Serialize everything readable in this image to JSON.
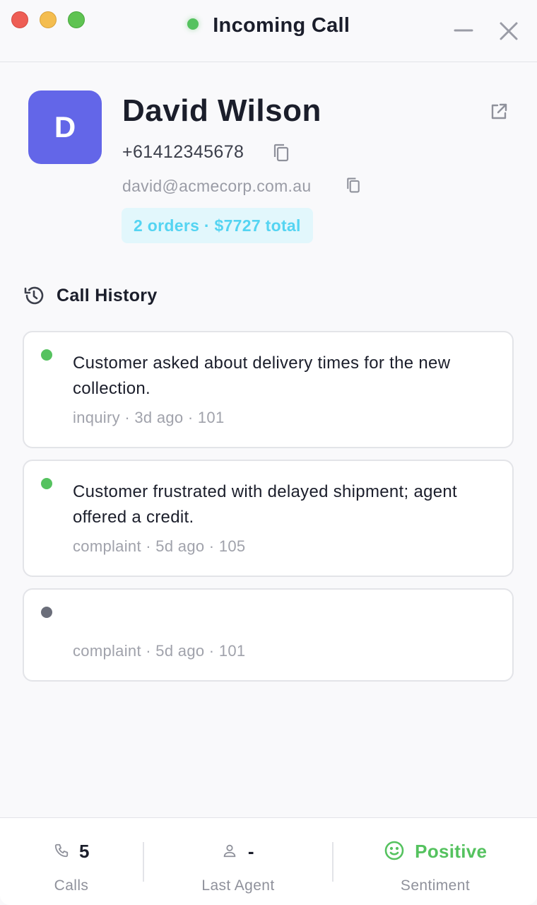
{
  "window": {
    "title": "Incoming Call",
    "status_color": "#55c25f"
  },
  "contact": {
    "avatar_initial": "D",
    "avatar_color": "#6366e8",
    "name": "David Wilson",
    "phone": "+61412345678",
    "email": "david@acmecorp.com.au",
    "orders_badge": "2 orders · $7727 total",
    "icons": {
      "open": "external-link-icon",
      "copy_phone": "copy-icon",
      "copy_email": "copy-icon"
    }
  },
  "history": {
    "title": "Call History",
    "icon": "history-icon",
    "items": [
      {
        "status": "green",
        "text": "Customer asked about delivery times for the new collection.",
        "meta": "inquiry · 3d ago · 101"
      },
      {
        "status": "green",
        "text": "Customer frustrated with delayed shipment; agent offered a credit.",
        "meta": "complaint · 5d ago · 105"
      },
      {
        "status": "gray",
        "text": "",
        "meta": "complaint · 5d ago · 101"
      }
    ]
  },
  "footer": {
    "calls": {
      "icon": "phone-icon",
      "value": "5",
      "label": "Calls"
    },
    "agent": {
      "icon": "user-icon",
      "value": "-",
      "label": "Last Agent"
    },
    "sentiment": {
      "icon": "smile-icon",
      "value": "Positive",
      "label": "Sentiment",
      "color": "#55c25f"
    }
  }
}
